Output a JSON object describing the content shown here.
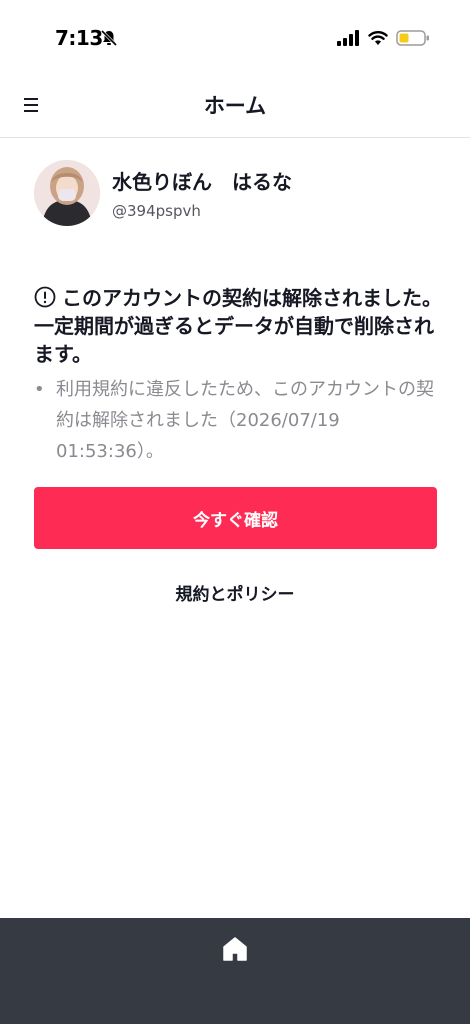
{
  "status_bar": {
    "time": "7:13"
  },
  "header": {
    "title": "ホーム",
    "menu_icon": "hamburger-menu-icon"
  },
  "profile": {
    "display_name": "水色りぼん　はるな",
    "username": "@394pspvh"
  },
  "notice": {
    "title": "このアカウントの契約は解除されました。一定期間が過ぎるとデータが自動で削除されます。",
    "bullet": "•",
    "body": "利用規約に違反したため、このアカウントの契約は解除されました（2026/07/19 01:53:36）。"
  },
  "actions": {
    "confirm_label": "今すぐ確認",
    "policy_label": "規約とポリシー"
  },
  "colors": {
    "accent": "#fe2c55",
    "bottom_bar": "#363a42",
    "muted_text": "#8a8b91"
  },
  "bottom_nav": {
    "home_icon": "home-icon"
  }
}
